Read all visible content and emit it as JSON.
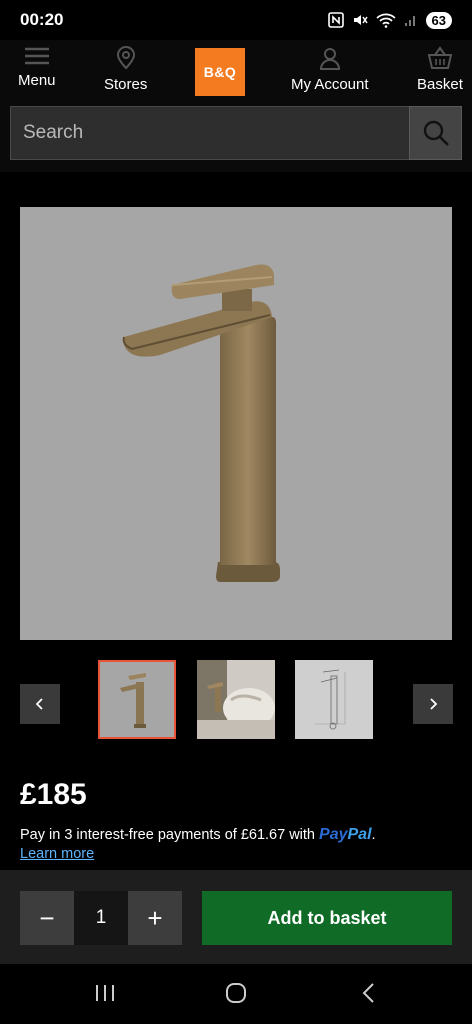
{
  "status": {
    "time": "00:20",
    "battery": "63"
  },
  "nav": {
    "menu": "Menu",
    "stores": "Stores",
    "logo": "B&Q",
    "account": "My Account",
    "basket": "Basket"
  },
  "search": {
    "placeholder": "Search"
  },
  "product": {
    "price": "£185",
    "installments_prefix": "Pay in 3 interest-free payments of £61.67 with",
    "paypal_part1": "Pay",
    "paypal_part2": "Pal",
    "installments_suffix": ".",
    "learn_more": "Learn more"
  },
  "basket": {
    "decrement": "−",
    "quantity": "1",
    "increment": "+",
    "add_label": "Add to basket"
  },
  "colors": {
    "brand_orange": "#f47b20",
    "add_button_green": "#0f6b26",
    "link_blue": "#5eb4ff",
    "active_thumb_border": "#e8543a"
  }
}
